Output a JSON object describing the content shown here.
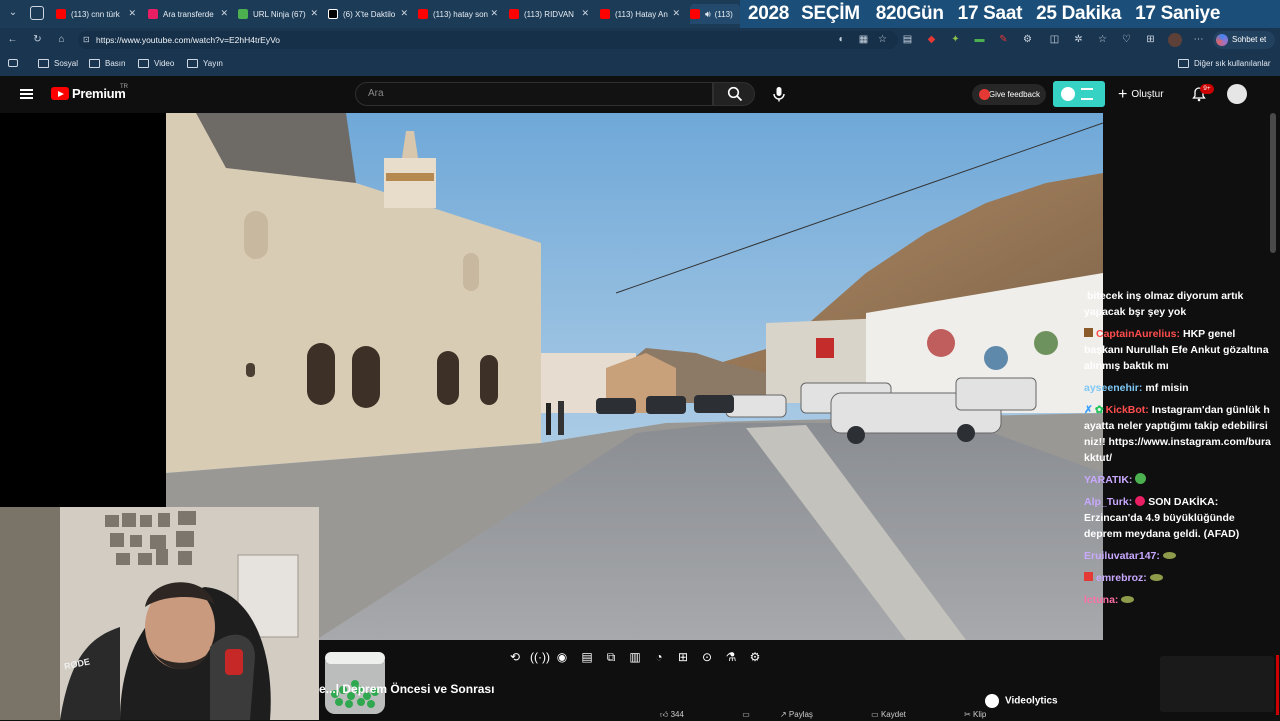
{
  "browser": {
    "tabs": [
      {
        "title": "(113) cnn türk",
        "favicon_color": "#ff0000"
      },
      {
        "title": "Ara transferde",
        "favicon_color": "#e91e63"
      },
      {
        "title": "URL Ninja (67)",
        "favicon_color": "#4caf50"
      },
      {
        "title": "(6) X'te Daktilo",
        "favicon_color": "#000000"
      },
      {
        "title": "(113) hatay son",
        "favicon_color": "#ff0000"
      },
      {
        "title": "(113) RIDVAN",
        "favicon_color": "#ff0000"
      },
      {
        "title": "(113) Hatay An",
        "favicon_color": "#ff0000"
      },
      {
        "title": "(113)",
        "favicon_color": "#ff0000"
      }
    ],
    "countdown": {
      "year": "2028",
      "label": "SEÇİM",
      "days": "820Gün",
      "hours": "17 Saat",
      "minutes": "25 Dakika",
      "seconds": "17 Saniye"
    },
    "url": "https://www.youtube.com/watch?v=E2hH4trEyVo",
    "chat_button": "Sohbet et",
    "bookmarks": [
      "Sosyal",
      "Basın",
      "Video",
      "Yayın"
    ],
    "other_bookmarks": "Diğer sık kullanılanlar"
  },
  "youtube": {
    "brand": "Premium",
    "region": "TR",
    "search_placeholder": "Ara",
    "feedback_label": "Give feedback",
    "create_label": "Oluştur",
    "notification_count": "9+"
  },
  "chat": [
    {
      "user": "",
      "text": "bitecek inş olmaz diyorum artık yapacak bşr şey yok",
      "color": "#ffffff"
    },
    {
      "user": "CaptainAurelius:",
      "text": "HKP genel başkanı Nurullah Efe Ankut gözaltına alınmış baktık mı",
      "color": "#ff4d4d"
    },
    {
      "user": "ayseenehir:",
      "text": "mf misin",
      "color": "#7ec8f5"
    },
    {
      "user": "KickBot:",
      "text": "Instagram'dan günlük hayatta neler yaptığımı takip edebilirsiniz!! https://www.instagram.com/burakktut/",
      "color": "#ff4d4d"
    },
    {
      "user": "YARATIK:",
      "text": "",
      "color": "#c9a9ff"
    },
    {
      "user": "Alp_Turk:",
      "text": "SON DAKİKA: Erzincan'da 4.9 büyüklüğünde deprem meydana geldi. (AFAD)",
      "color": "#c9a9ff"
    },
    {
      "user": "Eruiluvatar147:",
      "text": "",
      "color": "#c9a9ff"
    },
    {
      "user": "emrebroz:",
      "text": "",
      "color": "#c9a9ff"
    },
    {
      "user": "lctuna:",
      "text": "",
      "color": "#ff6fa6"
    }
  ],
  "player": {
    "title": "e...| Deprem Öncesi ve Sonrası",
    "videolytics": "Videolytics",
    "likes": "344",
    "share": "Paylaş",
    "save": "Kaydet",
    "clip": "Klip"
  }
}
